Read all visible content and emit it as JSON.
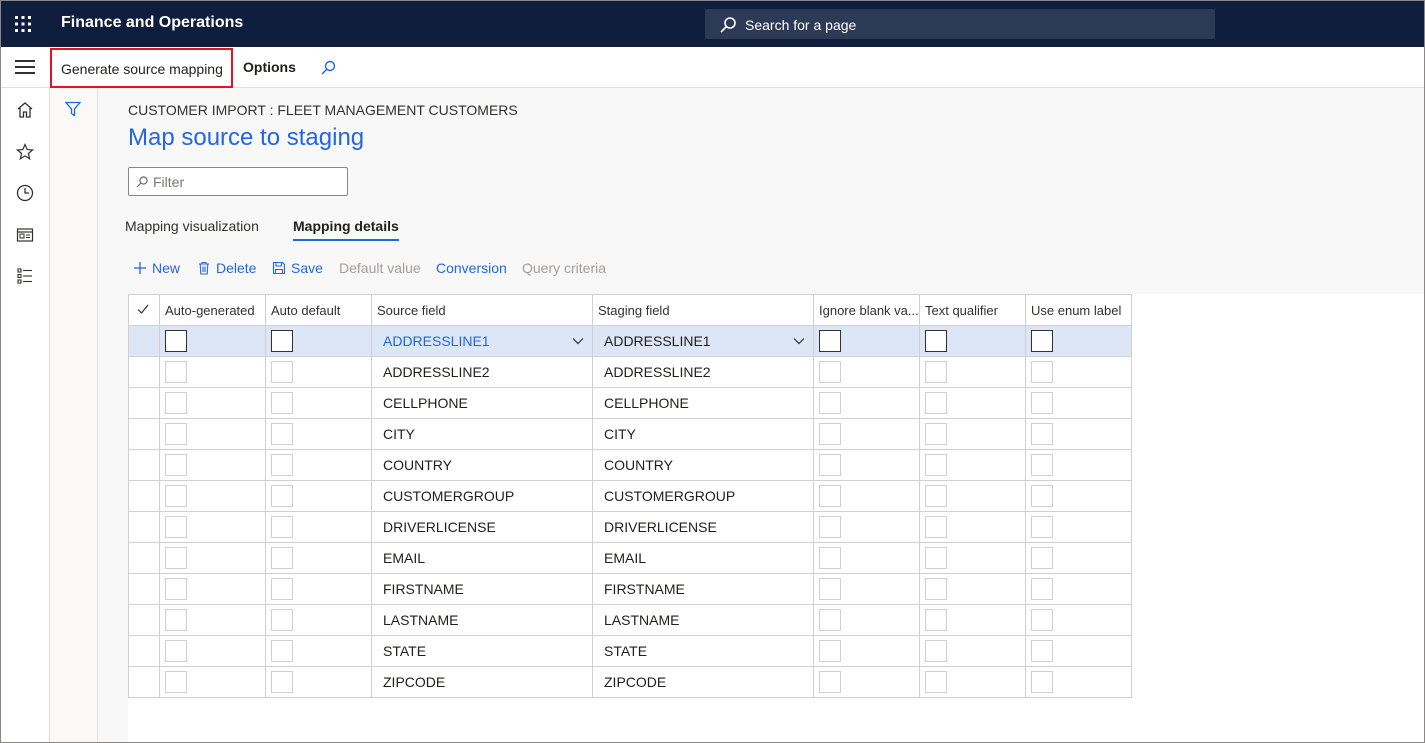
{
  "app": {
    "title": "Finance and Operations",
    "search_placeholder": "Search for a page"
  },
  "action_pane": {
    "generate_label": "Generate source mapping",
    "options_label": "Options"
  },
  "page": {
    "caption": "CUSTOMER IMPORT : FLEET MANAGEMENT CUSTOMERS",
    "title": "Map source to staging",
    "filter_placeholder": "Filter"
  },
  "tabs": {
    "visualization": "Mapping visualization",
    "details": "Mapping details"
  },
  "toolbar": {
    "new": "New",
    "delete": "Delete",
    "save": "Save",
    "default_value": "Default value",
    "conversion": "Conversion",
    "query_criteria": "Query criteria"
  },
  "grid": {
    "headers": {
      "auto_generated": "Auto-generated",
      "auto_default": "Auto default",
      "source_field": "Source field",
      "staging_field": "Staging field",
      "ignore_blank": "Ignore blank va...",
      "text_qualifier": "Text qualifier",
      "use_enum_label": "Use enum label"
    },
    "rows": [
      {
        "source": "ADDRESSLINE1",
        "staging": "ADDRESSLINE1"
      },
      {
        "source": "ADDRESSLINE2",
        "staging": "ADDRESSLINE2"
      },
      {
        "source": "CELLPHONE",
        "staging": "CELLPHONE"
      },
      {
        "source": "CITY",
        "staging": "CITY"
      },
      {
        "source": "COUNTRY",
        "staging": "COUNTRY"
      },
      {
        "source": "CUSTOMERGROUP",
        "staging": "CUSTOMERGROUP"
      },
      {
        "source": "DRIVERLICENSE",
        "staging": "DRIVERLICENSE"
      },
      {
        "source": "EMAIL",
        "staging": "EMAIL"
      },
      {
        "source": "FIRSTNAME",
        "staging": "FIRSTNAME"
      },
      {
        "source": "LASTNAME",
        "staging": "LASTNAME"
      },
      {
        "source": "STATE",
        "staging": "STATE"
      },
      {
        "source": "ZIPCODE",
        "staging": "ZIPCODE"
      }
    ]
  },
  "colors": {
    "topbar": "#0f1e3d",
    "accent": "#2266e3",
    "highlight_border": "#e81123",
    "selected_row": "#dce6f7"
  }
}
